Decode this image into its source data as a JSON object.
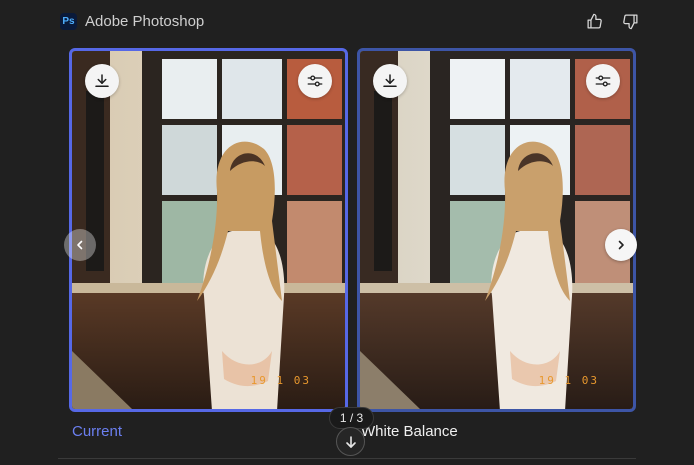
{
  "header": {
    "logo_text": "Ps",
    "app_name": "Adobe Photoshop",
    "thumbs_up_icon": "thumbs-up-icon",
    "thumbs_down_icon": "thumbs-down-icon"
  },
  "cards": [
    {
      "label": "Current",
      "date_stamp": "19 1 03",
      "selected": true,
      "download_icon": "download-icon",
      "adjust_icon": "sliders-icon"
    },
    {
      "label": "White Balance",
      "date_stamp": "19 1 03",
      "selected": false,
      "download_icon": "download-icon",
      "adjust_icon": "sliders-icon"
    }
  ],
  "carousel": {
    "counter": "1 / 3",
    "prev_icon": "chevron-left-icon",
    "next_icon": "chevron-right-icon",
    "scroll_icon": "arrow-down-icon"
  },
  "colors": {
    "background": "#202020",
    "accent": "#5668e6",
    "accent_label": "#6b7ff0",
    "date_stamp": "#e8982e"
  }
}
